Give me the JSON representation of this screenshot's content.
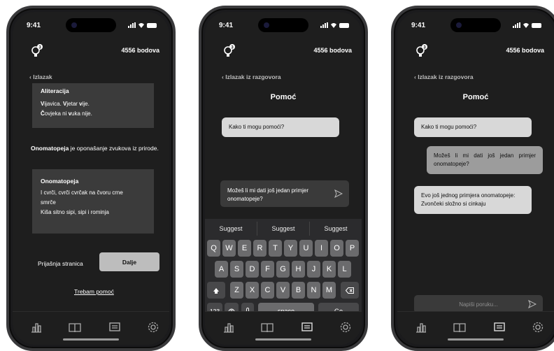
{
  "status": {
    "time": "9:41"
  },
  "header": {
    "points": "4556 bodova",
    "badge": "3"
  },
  "screen1": {
    "back_label": "Izlazak",
    "card1": {
      "title": "Aliteracija",
      "line1_bold": "V",
      "line1": "ijavica. ",
      "line1b_bold": "V",
      "line1b": "jetar ",
      "line1c_bold": "v",
      "line1c": "ije.",
      "line2_bold": "Č",
      "line2": "ovjeka ni ",
      "line2b_bold": "v",
      "line2b": "uka nije."
    },
    "paragraph": {
      "term": "Onomatopeja",
      "rest": " je oponašanje zvukova iz prirode."
    },
    "card2": {
      "title": "Onomatopeja",
      "line1": "I cvrči, cvrči cvrčak na čvoru crne smrče",
      "line2": "Kiša sitno sipi, sipi i rominja"
    },
    "prev_label": "Prijašnja stranica",
    "next_label": "Dalje",
    "help_label": "Trebam pomoć"
  },
  "screen2": {
    "back_label": "Izlazak iz razgovora",
    "title": "Pomoć",
    "bot_message": "Kako ti mogu pomoći?",
    "draft_text": "Možeš li mi dati još jedan primjer onomatopeje?",
    "suggestions": [
      "Suggest",
      "Suggest",
      "Suggest"
    ],
    "keys_row1": [
      "Q",
      "W",
      "E",
      "R",
      "T",
      "Y",
      "U",
      "I",
      "O",
      "P"
    ],
    "keys_row2": [
      "A",
      "S",
      "D",
      "F",
      "G",
      "H",
      "J",
      "K",
      "L"
    ],
    "keys_row3": [
      "Z",
      "X",
      "C",
      "V",
      "B",
      "N",
      "M"
    ],
    "key_123": "123",
    "key_space": "space",
    "key_go": "Go"
  },
  "screen3": {
    "back_label": "Izlazak iz razgovora",
    "title": "Pomoć",
    "bot_message1": "Kako ti mogu pomoći?",
    "user_message": "Možeš li mi dati još jedan primjer onomatopeje?",
    "bot_message2": "Evo još jednog primjera onomatopeje: Zvončeki složno si cinkaju",
    "input_placeholder": "Napiši poruku..."
  },
  "nav_icons": [
    "chart-icon",
    "book-icon",
    "chat-icon",
    "gear-icon"
  ],
  "colors": {
    "background": "#1e1e1e",
    "card": "#3b3b3b",
    "bubble_bot": "#d8d8d8",
    "bubble_user": "#9c9c9c",
    "button": "#bdbdbd"
  }
}
